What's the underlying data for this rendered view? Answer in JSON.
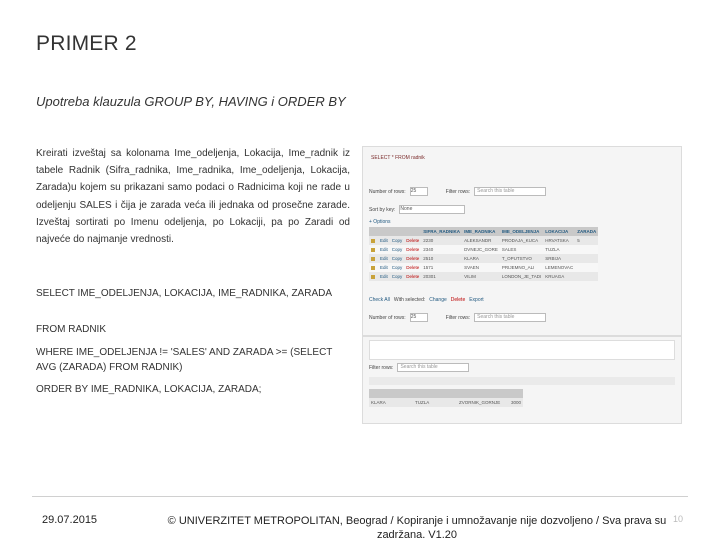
{
  "slide": {
    "title": "PRIMER 2",
    "subtitle": "Upotreba klauzula GROUP BY, HAVING i ORDER BY",
    "paragraph": "Kreirati izveštaj sa kolonama Ime_odeljenja, Lokacija, Ime_radnik iz tabele Radnik (Sifra_radnika, Ime_radnika, Ime_odeljenja, Lokacija, Zarada)u kojem su prikazani samo podaci o Radnicima koji ne rade u odeljenju SALES i čija je zarada veća ili jednaka od prosečne zarade. Izveštaj sortirati po Imenu odeljenja, po Lokaciji, pa po Zaradi od najveće do najmanje vrednosti.",
    "sql": {
      "line1": "SELECT IME_ODELJENJA, LOKACIJA, IME_RADNIKA, ZARADA",
      "line2": "FROM RADNIK",
      "line3": "WHERE IME_ODELJENJA != 'SALES' AND ZARADA >= (SELECT AVG (ZARADA) FROM RADNIK)",
      "line4": "ORDER BY IME_RADNIKA, LOKACIJA, ZARADA;"
    }
  },
  "footer": {
    "date": "29.07.2015",
    "copyright": "© UNIVERZITET METROPOLITAN, Beograd / Kopiranje i umnožavanje nije dozvoljeno / Sva prava su zadržana. V1.20",
    "page": "10"
  },
  "screenshot1": {
    "breadcrumb": "SELECT * FROM radnik",
    "rows_label": "Number of rows:",
    "rows_value": "25",
    "filter_label": "Filter rows:",
    "filter_placeholder": "Search this table",
    "sort_label": "Sort by key:",
    "sort_value": "None",
    "options_label": "+ Options",
    "headers": [
      "SIFRA_RADNIKA",
      "IME_RADNIKA",
      "IME_ODELJENJA",
      "LOKACIJA",
      "ZARADA"
    ],
    "edit_label": "Edit",
    "copy_label": "Copy",
    "delete_label": "Delete",
    "rows": [
      [
        "2230",
        "ALEKSANDR",
        "PRODAJA_KUCA",
        "HRVATSKA",
        "5"
      ],
      [
        "2340",
        "DVNEJC_GORE",
        "SALES",
        "TUZLA",
        ""
      ],
      [
        "2510",
        "KLARA",
        "T_OPUTSTVO",
        "SRBIJA",
        ""
      ],
      [
        "1571",
        "SVAEN",
        "PRIJEMNO_ALI",
        "LEMENOVAC",
        ""
      ],
      [
        "20301",
        "VILIM",
        "LONDON_JE_TADI",
        "KRUAGA",
        ""
      ],
      [
        "",
        "",
        "",
        "",
        ""
      ]
    ],
    "checkall_label": "Check All",
    "withselected_label": "With selected:",
    "change_label": "Change",
    "export_label": "Export"
  },
  "screenshot2": {
    "filter_label": "Filter rows:",
    "filter_placeholder": "Search this table",
    "row": [
      "KLARA",
      "TUZLA",
      "ZVORNIK_GORNJE",
      "3000"
    ]
  }
}
